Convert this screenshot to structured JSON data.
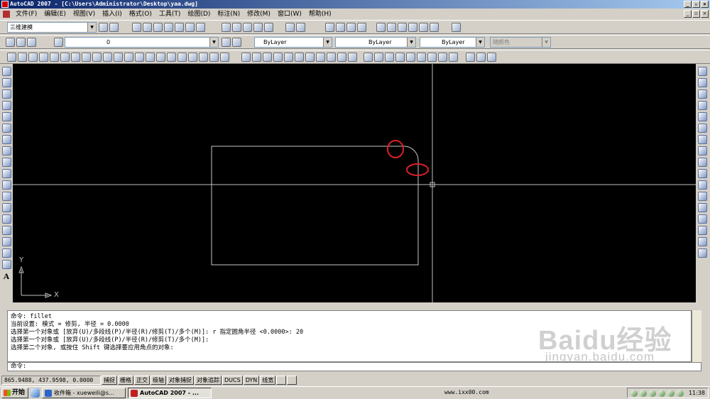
{
  "window": {
    "title": "AutoCAD 2007 - [C:\\Users\\Administrator\\Desktop\\yaa.dwg]",
    "controls": [
      "_",
      "▫",
      "×"
    ],
    "doc_controls": [
      "_",
      "▫",
      "×"
    ]
  },
  "menu": [
    "文件(F)",
    "编辑(E)",
    "视图(V)",
    "插入(I)",
    "格式(O)",
    "工具(T)",
    "绘图(D)",
    "标注(N)",
    "修改(M)",
    "窗口(W)",
    "帮助(H)"
  ],
  "toolbar": {
    "workspace": "三维建模",
    "layer": "0",
    "color": "ByLayer",
    "linetype": "ByLayer",
    "lineweight": "ByLayer",
    "plotstyle": "随颜色"
  },
  "drawing": {
    "ucs_y": "Y",
    "ucs_x": "X",
    "colors": {
      "canvas": "#000000",
      "lines": "#c0c0c0",
      "highlight": "#e0202a"
    }
  },
  "left_toolbar": {
    "text_tool": "A"
  },
  "command_history": [
    "命令:  fillet",
    "当前设置: 模式 = 修剪, 半径 = 0.0000",
    "选择第一个对象或 [放弃(U)/多段线(P)/半径(R)/修剪(T)/多个(M)]: r 指定圆角半径 <0.0000>: 20",
    "选择第一个对象或 [放弃(U)/多段线(P)/半径(R)/修剪(T)/多个(M)]:",
    "选择第二个对象, 或按住 Shift 键选择要应用角点的对象:"
  ],
  "command_prompt": "命令:",
  "status": {
    "coords": "865.9488,  437.9598, 0.0000",
    "buttons": [
      "捕捉",
      "栅格",
      "正交",
      "极轴",
      "对象捕捉",
      "对象追踪",
      "DUCS",
      "DYN",
      "线宽"
    ]
  },
  "taskbar": {
    "start": "开始",
    "items": [
      "收件箱 - xueweili@s...",
      "AutoCAD 2007 - ..."
    ],
    "tray_url": "www.ixx00.com",
    "time": "11:38"
  },
  "watermark": {
    "line1": "Baidu经验",
    "line2": "jingyan.baidu.com"
  }
}
